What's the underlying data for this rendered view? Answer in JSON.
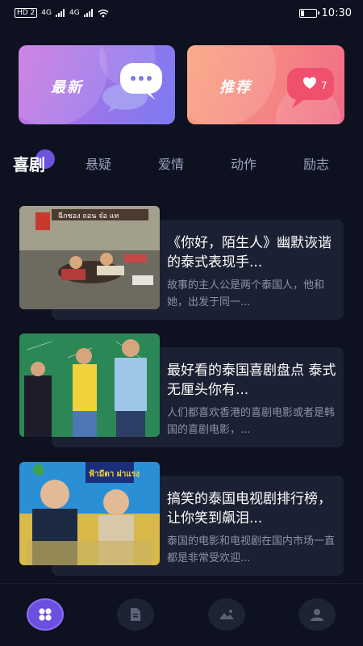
{
  "status_bar": {
    "network_label": "HD 2",
    "signal_1": "4G",
    "signal_2": "4G",
    "time": "10:30",
    "battery_level": 0.25
  },
  "banners": [
    {
      "label": "最新",
      "icon": "chat-bubble-icon"
    },
    {
      "label": "推荐",
      "icon": "heart-badge-icon",
      "badge": "7"
    }
  ],
  "tabs": [
    {
      "label": "喜剧",
      "active": true
    },
    {
      "label": "悬疑",
      "active": false
    },
    {
      "label": "爱情",
      "active": false
    },
    {
      "label": "动作",
      "active": false
    },
    {
      "label": "励志",
      "active": false
    }
  ],
  "articles": [
    {
      "title": "《你好，陌生人》幽默诙谐的泰式表现手...",
      "desc": "故事的主人公是两个泰国人，他和她，出发于同一...",
      "thumb_text": "ฉีกซอง ถอน จ๋อ แท"
    },
    {
      "title": "最好看的泰国喜剧盘点 泰式无厘头你有...",
      "desc": "人们都喜欢香港的喜剧电影或者是韩国的喜剧电影，..."
    },
    {
      "title": "搞笑的泰国电视剧排行榜，让你笑到飙泪...",
      "desc": "泰国的电影和电视剧在国内市场一直都是非常受欢迎...",
      "thumb_text": "ฟ้ามีตา ผ่าแรง"
    }
  ],
  "bottom_nav": [
    {
      "icon": "grid-icon",
      "active": true
    },
    {
      "icon": "document-icon",
      "active": false
    },
    {
      "icon": "image-icon",
      "active": false
    },
    {
      "icon": "user-icon",
      "active": false
    }
  ],
  "colors": {
    "background": "#0d1120",
    "card": "#1b2032",
    "accent": "#6c4fe0",
    "tab_inactive": "#9aa1b8",
    "desc_text": "#8e94a6"
  }
}
